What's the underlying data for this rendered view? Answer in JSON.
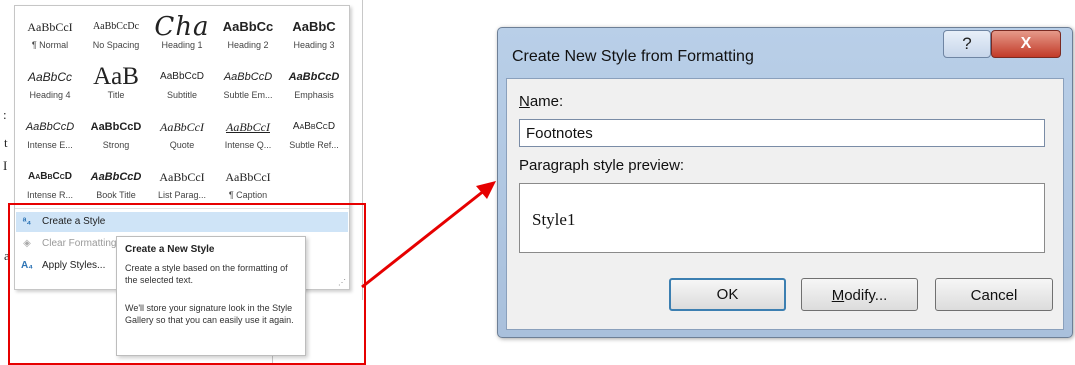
{
  "gallery": {
    "styles": [
      {
        "sample": "AaBbCcI",
        "name": "¶ Normal"
      },
      {
        "sample": "AaBbCcDc",
        "name": "No Spacing"
      },
      {
        "sample": "Cha",
        "name": "Heading 1"
      },
      {
        "sample": "AaBbCc",
        "name": "Heading 2"
      },
      {
        "sample": "AaBbC",
        "name": "Heading 3"
      },
      {
        "sample": "AaBbCc",
        "name": "Heading 4"
      },
      {
        "sample": "AaB",
        "name": "Title"
      },
      {
        "sample": "AaBbCcD",
        "name": "Subtitle"
      },
      {
        "sample": "AaBbCcD",
        "name": "Subtle Em..."
      },
      {
        "sample": "AaBbCcD",
        "name": "Emphasis"
      },
      {
        "sample": "AaBbCcD",
        "name": "Intense E..."
      },
      {
        "sample": "AaBbCcD",
        "name": "Strong"
      },
      {
        "sample": "AaBbCcI",
        "name": "Quote"
      },
      {
        "sample": "AaBbCcI",
        "name": "Intense Q..."
      },
      {
        "sample": "AaBbCcD",
        "name": "Subtle Ref..."
      },
      {
        "sample": "AaBbCcD",
        "name": "Intense R..."
      },
      {
        "sample": "AaBbCcD",
        "name": "Book Title"
      },
      {
        "sample": "AaBbCcI",
        "name": "List Parag..."
      },
      {
        "sample": "AaBbCcI",
        "name": "¶ Caption"
      }
    ],
    "menu": {
      "create": "Create a Style",
      "clear": "Clear Formatting",
      "apply": "Apply Styles..."
    },
    "doc_chars": [
      ":",
      "t",
      "I",
      "a"
    ]
  },
  "tooltip": {
    "title": "Create a New Style",
    "p1": "Create a style based on the formatting of the selected text.",
    "p2": "We'll store your signature look in the Style Gallery so that you can easily use it again."
  },
  "dialog": {
    "title": "Create New Style from Formatting",
    "help": "?",
    "close": "X",
    "name_label_rest": "ame:",
    "name_label_acc": "N",
    "name_value": "Footnotes",
    "preview_label": "Paragraph style preview:",
    "preview_text": "Style1",
    "ok": "OK",
    "modify_acc": "M",
    "modify_rest": "odify...",
    "cancel": "Cancel"
  },
  "colors": {
    "highlight": "#e60000",
    "accent_blue": "#2e74b5",
    "menu_hover": "#cfe4f7"
  }
}
